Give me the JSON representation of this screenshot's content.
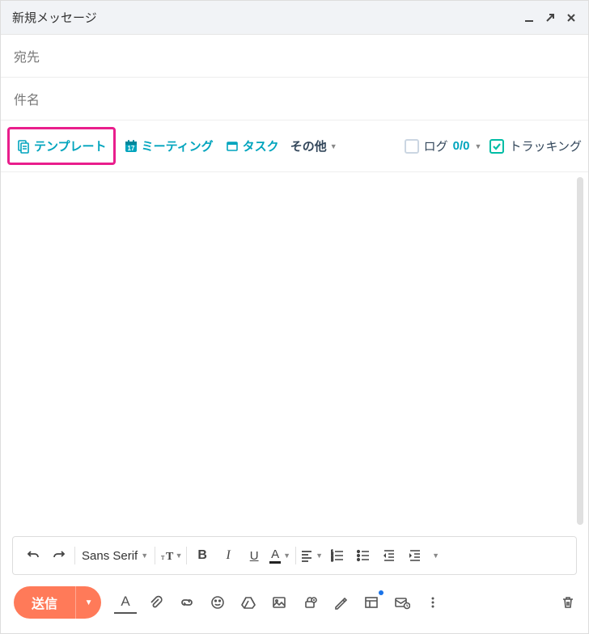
{
  "header": {
    "title": "新規メッセージ"
  },
  "fields": {
    "to_label": "宛先",
    "subject_label": "件名"
  },
  "hubspot": {
    "template": "テンプレート",
    "meeting": "ミーティング",
    "task": "タスク",
    "other": "その他",
    "log_label": "ログ",
    "log_count": "0/0",
    "tracking_label": "トラッキング"
  },
  "toolbar": {
    "font_family": "Sans Serif"
  },
  "send": {
    "label": "送信"
  }
}
